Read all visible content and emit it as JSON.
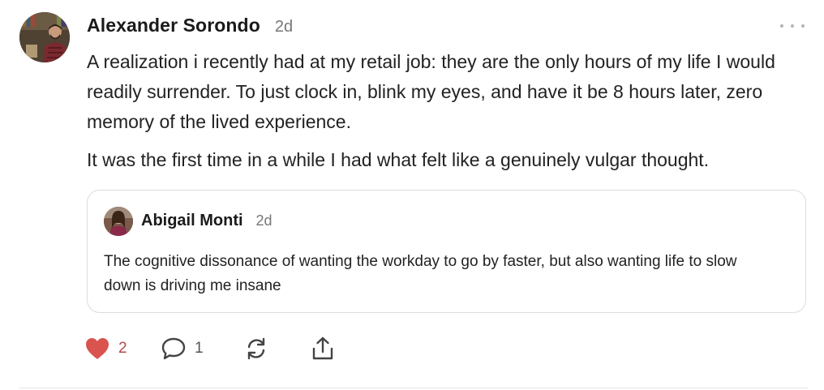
{
  "post": {
    "author": "Alexander Sorondo",
    "timestamp": "2d",
    "paragraphs": [
      "A realization i recently had at my retail job: they are the only hours of my life I would readily surrender. To just clock in, blink my eyes, and have it be 8 hours later, zero memory of the lived experience.",
      "It was the first time in a while I had what felt like a genuinely vulgar thought."
    ],
    "quoted": {
      "author": "Abigail Monti",
      "timestamp": "2d",
      "text": "The cognitive dissonance of wanting the workday to go by faster, but also wanting life to slow down is driving me insane"
    },
    "actions": {
      "like_count": "2",
      "comment_count": "1"
    },
    "icons": {
      "more": "more-horizontal-icon",
      "like": "heart-icon",
      "comment": "comment-bubble-icon",
      "restack": "restack-icon",
      "share": "share-icon"
    },
    "colors": {
      "heart": "#d9534f",
      "like_count": "#b24a4a"
    }
  }
}
